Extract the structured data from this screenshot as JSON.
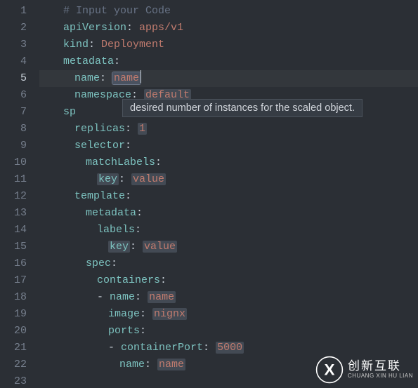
{
  "tooltip": "desired number of instances for the scaled object.",
  "activeLine": 5,
  "lines": [
    {
      "n": 1,
      "indent": 0,
      "type": "comment",
      "text": "# Input your Code"
    },
    {
      "n": 2,
      "indent": 0,
      "key": "apiVersion",
      "val": "apps/v1"
    },
    {
      "n": 3,
      "indent": 0,
      "key": "kind",
      "val": "Deployment"
    },
    {
      "n": 4,
      "indent": 0,
      "key": "metadata"
    },
    {
      "n": 5,
      "indent": 1,
      "key": "name",
      "val": "name",
      "ph": true,
      "phActive": true,
      "cursor": true
    },
    {
      "n": 6,
      "indent": 1,
      "key": "namespace",
      "val": "default",
      "ph": true
    },
    {
      "n": 7,
      "indent": 0,
      "key": "sp",
      "partial": true
    },
    {
      "n": 8,
      "indent": 1,
      "key": "replicas",
      "val": "1",
      "ph": true
    },
    {
      "n": 9,
      "indent": 1,
      "key": "selector"
    },
    {
      "n": 10,
      "indent": 2,
      "key": "matchLabels"
    },
    {
      "n": 11,
      "indent": 3,
      "key": "key",
      "val": "value",
      "phKey": true,
      "ph": true
    },
    {
      "n": 12,
      "indent": 1,
      "key": "template"
    },
    {
      "n": 13,
      "indent": 2,
      "key": "metadata"
    },
    {
      "n": 14,
      "indent": 3,
      "key": "labels"
    },
    {
      "n": 15,
      "indent": 4,
      "key": "key",
      "val": "value",
      "phKey": true,
      "ph": true
    },
    {
      "n": 16,
      "indent": 2,
      "key": "spec"
    },
    {
      "n": 17,
      "indent": 3,
      "key": "containers"
    },
    {
      "n": 18,
      "indent": 3,
      "dash": true,
      "key": "name",
      "val": "name",
      "ph": true
    },
    {
      "n": 19,
      "indent": 4,
      "key": "image",
      "val": "nignx",
      "ph": true
    },
    {
      "n": 20,
      "indent": 4,
      "key": "ports"
    },
    {
      "n": 21,
      "indent": 4,
      "dash": true,
      "key": "containerPort",
      "val": "5000",
      "ph": true
    },
    {
      "n": 22,
      "indent": 5,
      "key": "name",
      "val": "name",
      "ph": true
    },
    {
      "n": 23,
      "indent": 0,
      "blank": true
    }
  ],
  "watermark": {
    "main": "创新互联",
    "sub": "CHUANG XIN HU LIAN"
  }
}
